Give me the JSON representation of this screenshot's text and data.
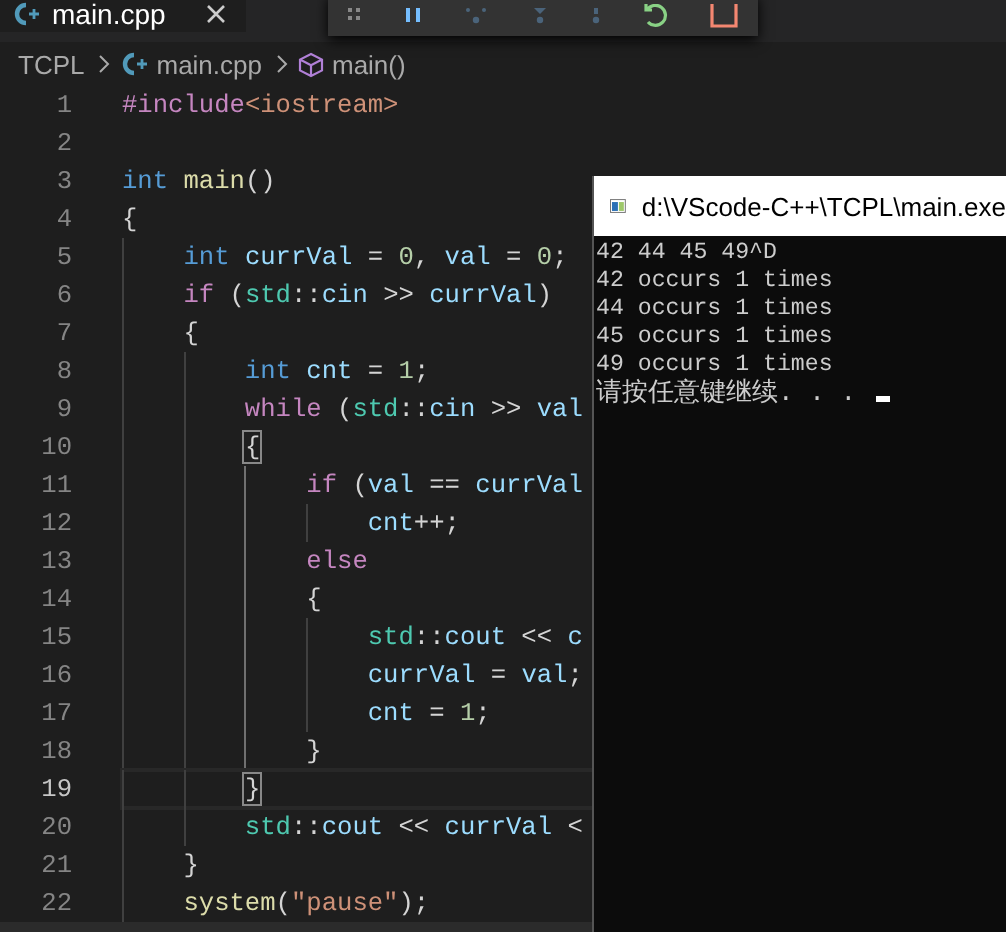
{
  "tab": {
    "label": "main.cpp",
    "selected": true
  },
  "debug_toolbar": [
    {
      "kind": "grip",
      "disabled": false
    },
    {
      "kind": "pause",
      "disabled": false
    },
    {
      "kind": "step-over",
      "disabled": true
    },
    {
      "kind": "step-into",
      "disabled": true
    },
    {
      "kind": "step-out",
      "disabled": true
    },
    {
      "kind": "restart",
      "disabled": false
    },
    {
      "kind": "stop",
      "disabled": false
    }
  ],
  "breadcrumb": [
    {
      "label": "TCPL",
      "kind": "folder"
    },
    {
      "label": "main.cpp",
      "kind": "file"
    },
    {
      "label": "main()",
      "kind": "function"
    }
  ],
  "code_lines": [
    {
      "number": "1",
      "current": false,
      "tokens": [
        {
          "text": "#include",
          "kind": "directive"
        },
        {
          "text": "<iostream>",
          "kind": "string"
        }
      ]
    },
    {
      "number": "2",
      "current": false
    },
    {
      "number": "3",
      "current": false,
      "tokens": [
        {
          "text": "int",
          "kind": "type"
        },
        {
          "text": " main",
          "kind": "func"
        },
        {
          "text": "()",
          "kind": "punct"
        }
      ]
    },
    {
      "number": "4",
      "current": false,
      "tokens": [
        {
          "text": "{",
          "kind": "punct"
        }
      ]
    },
    {
      "number": "5",
      "current": false,
      "tokens": [
        {
          "text": "    int",
          "kind": "type"
        },
        {
          "text": " currVal",
          "kind": "var"
        },
        {
          "text": " = ",
          "kind": "punct"
        },
        {
          "text": "0",
          "kind": "number"
        },
        {
          "text": ", ",
          "kind": "punct"
        },
        {
          "text": "val",
          "kind": "var"
        },
        {
          "text": " = ",
          "kind": "punct"
        },
        {
          "text": "0",
          "kind": "number"
        },
        {
          "text": ";",
          "kind": "punct"
        }
      ]
    },
    {
      "number": "6",
      "current": false,
      "tokens": [
        {
          "text": "    if",
          "kind": "keyword"
        },
        {
          "text": " (",
          "kind": "punct"
        },
        {
          "text": "std",
          "kind": "namespace"
        },
        {
          "text": "::",
          "kind": "punct"
        },
        {
          "text": "cin",
          "kind": "var"
        },
        {
          "text": " >> ",
          "kind": "punct"
        },
        {
          "text": "currVal",
          "kind": "var"
        },
        {
          "text": ")",
          "kind": "punct"
        }
      ]
    },
    {
      "number": "7",
      "current": false,
      "tokens": [
        {
          "text": "    {",
          "kind": "punct"
        }
      ]
    },
    {
      "number": "8",
      "current": false,
      "tokens": [
        {
          "text": "        int",
          "kind": "type"
        },
        {
          "text": " cnt",
          "kind": "var"
        },
        {
          "text": " = ",
          "kind": "punct"
        },
        {
          "text": "1",
          "kind": "number"
        },
        {
          "text": ";",
          "kind": "punct"
        }
      ]
    },
    {
      "number": "9",
      "current": false,
      "tokens": [
        {
          "text": "        while",
          "kind": "keyword"
        },
        {
          "text": " (",
          "kind": "punct"
        },
        {
          "text": "std",
          "kind": "namespace"
        },
        {
          "text": "::",
          "kind": "punct"
        },
        {
          "text": "cin",
          "kind": "var"
        },
        {
          "text": " >> ",
          "kind": "punct"
        },
        {
          "text": "val",
          "kind": "var"
        }
      ]
    },
    {
      "number": "10",
      "current": false,
      "tokens": [
        {
          "text": "        {",
          "kind": "bracket-match"
        }
      ]
    },
    {
      "number": "11",
      "current": false,
      "tokens": [
        {
          "text": "            if",
          "kind": "keyword"
        },
        {
          "text": " (",
          "kind": "punct"
        },
        {
          "text": "val",
          "kind": "var"
        },
        {
          "text": " == ",
          "kind": "punct"
        },
        {
          "text": "currVal",
          "kind": "var"
        }
      ]
    },
    {
      "number": "12",
      "current": false,
      "tokens": [
        {
          "text": "                cnt",
          "kind": "var"
        },
        {
          "text": "++;",
          "kind": "punct"
        }
      ]
    },
    {
      "number": "13",
      "current": false,
      "tokens": [
        {
          "text": "            else",
          "kind": "keyword"
        }
      ]
    },
    {
      "number": "14",
      "current": false,
      "tokens": [
        {
          "text": "            {",
          "kind": "punct"
        }
      ]
    },
    {
      "number": "15",
      "current": false,
      "tokens": [
        {
          "text": "                std",
          "kind": "namespace"
        },
        {
          "text": "::",
          "kind": "punct"
        },
        {
          "text": "cout",
          "kind": "var"
        },
        {
          "text": " << ",
          "kind": "punct"
        },
        {
          "text": "c",
          "kind": "var"
        }
      ]
    },
    {
      "number": "16",
      "current": false,
      "tokens": [
        {
          "text": "                currVal",
          "kind": "var"
        },
        {
          "text": " = ",
          "kind": "punct"
        },
        {
          "text": "val",
          "kind": "var"
        },
        {
          "text": ";",
          "kind": "punct"
        }
      ]
    },
    {
      "number": "17",
      "current": false,
      "tokens": [
        {
          "text": "                cnt",
          "kind": "var"
        },
        {
          "text": " = ",
          "kind": "punct"
        },
        {
          "text": "1",
          "kind": "number"
        },
        {
          "text": ";",
          "kind": "punct"
        }
      ]
    },
    {
      "number": "18",
      "current": false,
      "tokens": [
        {
          "text": "            }",
          "kind": "punct"
        }
      ]
    },
    {
      "number": "19",
      "current": true,
      "tokens": [
        {
          "text": "        }",
          "kind": "bracket-match"
        }
      ]
    },
    {
      "number": "20",
      "current": false,
      "tokens": [
        {
          "text": "        std",
          "kind": "namespace"
        },
        {
          "text": "::",
          "kind": "punct"
        },
        {
          "text": "cout",
          "kind": "var"
        },
        {
          "text": " << ",
          "kind": "punct"
        },
        {
          "text": "currVal",
          "kind": "var"
        },
        {
          "text": " <",
          "kind": "punct"
        }
      ]
    },
    {
      "number": "21",
      "current": false,
      "tokens": [
        {
          "text": "    }",
          "kind": "punct"
        }
      ]
    },
    {
      "number": "22",
      "current": false,
      "tokens": [
        {
          "text": "    system",
          "kind": "func"
        },
        {
          "text": "(",
          "kind": "punct"
        },
        {
          "text": "\"pause\"",
          "kind": "string"
        },
        {
          "text": ");",
          "kind": "punct"
        }
      ]
    }
  ],
  "console": {
    "title": "d:\\VScode-C++\\TCPL\\main.exe",
    "lines": [
      "42 44 45 49^D",
      "42 occurs 1 times",
      "44 occurs 1 times",
      "45 occurs 1 times",
      "49 occurs 1 times",
      "请按任意键继续. . ."
    ]
  }
}
